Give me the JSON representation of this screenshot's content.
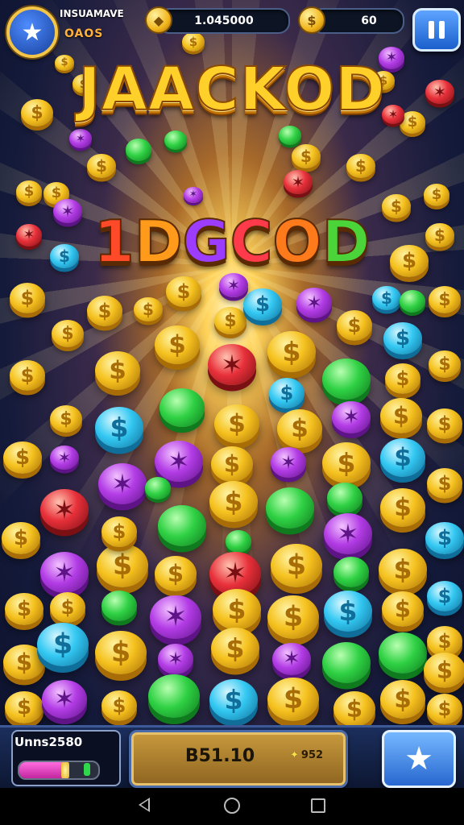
{
  "hud": {
    "player_name": "INSUAMAVE",
    "player_sub": "OAOS",
    "avatar_icon": "star-icon",
    "balance": "1.045000",
    "balance_icon": "gold-gem-icon",
    "coins": "60",
    "coins_icon": "gold-coin-icon",
    "pause_icon": "pause-icon"
  },
  "titles": {
    "main": "JAACKOD",
    "secondary": "1DGCOD",
    "secondary_colors": [
      "#ff4a2a",
      "#ff9a1a",
      "#9b3cff",
      "#ff3a4a",
      "#ff7a1a",
      "#4ad43a",
      "#ffd21a"
    ]
  },
  "bottom": {
    "score_label": "Unns2580",
    "score_progress": 0.55,
    "bet_value": "B51.10",
    "bet_sub": "952",
    "bet_sub_icon": "diamond-icon",
    "star_icon": "star-icon"
  },
  "nav": {
    "back_icon": "back-triangle-icon",
    "home_icon": "home-circle-icon",
    "recents_icon": "recents-square-icon"
  },
  "colors": {
    "gold": "#f5c21f",
    "green": "#2fd144",
    "cyan": "#33c8f2",
    "purple": "#b33ce6",
    "red": "#e8303a",
    "accent_blue": "#2767d0"
  }
}
